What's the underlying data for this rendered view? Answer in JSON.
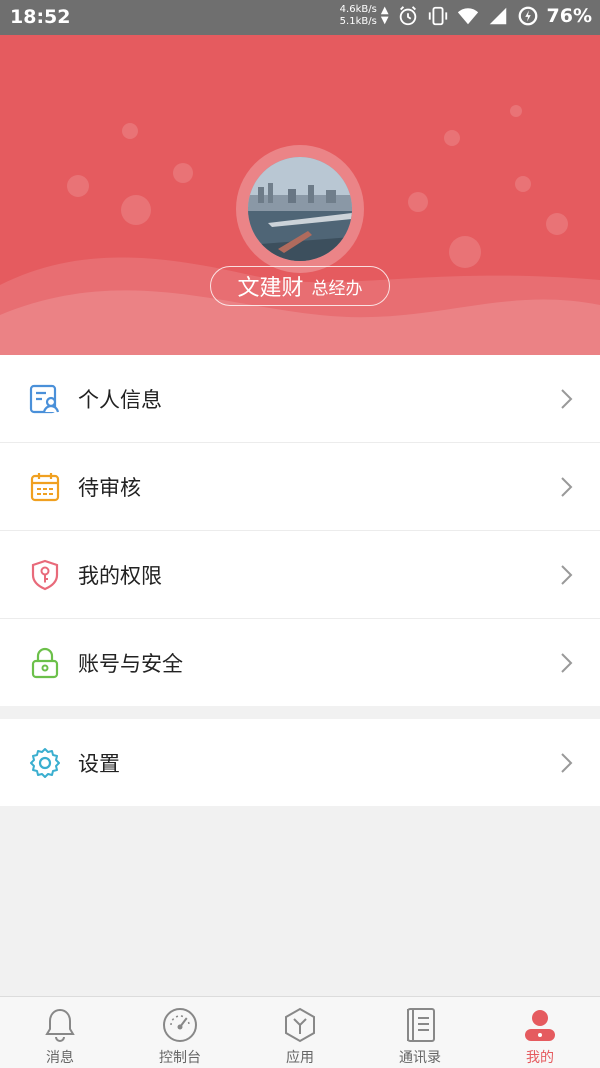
{
  "status_bar": {
    "time": "18:52",
    "up_speed": "4.6kB/s",
    "down_speed": "5.1kB/s",
    "battery": "76%",
    "icons": [
      "alarm-icon",
      "vibrate-icon",
      "wifi-icon",
      "signal-icon",
      "battery-saver-icon"
    ]
  },
  "profile": {
    "name": "文建财",
    "department": "总经办"
  },
  "menu_group_1": [
    {
      "label": "个人信息",
      "icon": "personal-info-icon"
    },
    {
      "label": "待审核",
      "icon": "calendar-icon"
    },
    {
      "label": "我的权限",
      "icon": "shield-key-icon"
    },
    {
      "label": "账号与安全",
      "icon": "lock-icon"
    }
  ],
  "menu_group_2": [
    {
      "label": "设置",
      "icon": "gear-icon"
    }
  ],
  "tabbar": {
    "tabs": [
      {
        "label": "消息",
        "icon": "bell-icon"
      },
      {
        "label": "控制台",
        "icon": "gauge-icon"
      },
      {
        "label": "应用",
        "icon": "hexagon-icon"
      },
      {
        "label": "通讯录",
        "icon": "notebook-icon"
      },
      {
        "label": "我的",
        "icon": "user-icon"
      }
    ],
    "active_index": 4
  },
  "colors": {
    "accent": "#e55b5f",
    "icon_blue": "#4a90d9",
    "icon_orange": "#f0a020",
    "icon_pink": "#e86a7a",
    "icon_green": "#6cc04a",
    "icon_teal": "#3aaecf"
  }
}
